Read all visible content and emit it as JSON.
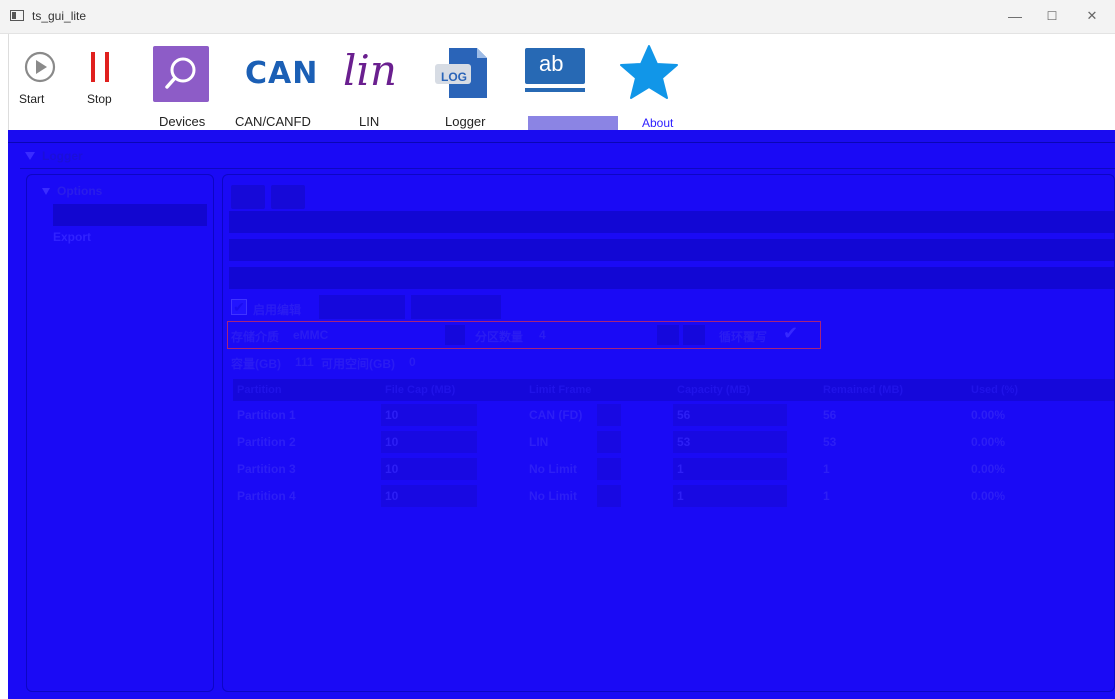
{
  "window": {
    "title": "ts_gui_lite",
    "minimize": "—",
    "maximize": "☐",
    "close": "✕"
  },
  "toolbar": {
    "start": "Start",
    "stop": "Stop",
    "devices": "Devices",
    "can_logo": "CAN",
    "can": "CAN/CANFD",
    "lin_logo": "lin",
    "lin": "LIN",
    "logger_logo": "LOG",
    "logger": "Logger",
    "ab_logo": "ab",
    "about": "About"
  },
  "logger": {
    "header": "Logger",
    "options": "Options",
    "export": "Export",
    "enable_label": "启用编辑",
    "storage_label": "存储介质",
    "storage_value": "eMMC",
    "partition_count_label": "分区数量",
    "partition_count_value": "4",
    "loop_label": "循环覆写",
    "capacity_label": "容量(GB)",
    "capacity_value": "111",
    "available_label": "可用空间(GB)",
    "available_value": "0"
  },
  "table": {
    "headers": [
      "Partition",
      "File Cap (MB)",
      "Limit Frame",
      "Capacity (MB)",
      "Remained (MB)",
      "Used (%)"
    ],
    "rows": [
      {
        "partition": "Partition 1",
        "file_cap": "10",
        "limit": "CAN (FD)",
        "capacity": "56",
        "remained": "56",
        "used": "0.00%"
      },
      {
        "partition": "Partition 2",
        "file_cap": "10",
        "limit": "LIN",
        "capacity": "53",
        "remained": "53",
        "used": "0.00%"
      },
      {
        "partition": "Partition 3",
        "file_cap": "10",
        "limit": "No Limit",
        "capacity": "1",
        "remained": "1",
        "used": "0.00%"
      },
      {
        "partition": "Partition 4",
        "file_cap": "10",
        "limit": "No Limit",
        "capacity": "1",
        "remained": "1",
        "used": "0.00%"
      }
    ]
  },
  "colors": {
    "overlay_blue": "#1a0af5",
    "stop_red": "#e0201e",
    "devices_purple": "#8d5cc7",
    "can_blue": "#1b5fb5",
    "lin_purple": "#6a1f8f",
    "star_blue": "#1196e8"
  }
}
